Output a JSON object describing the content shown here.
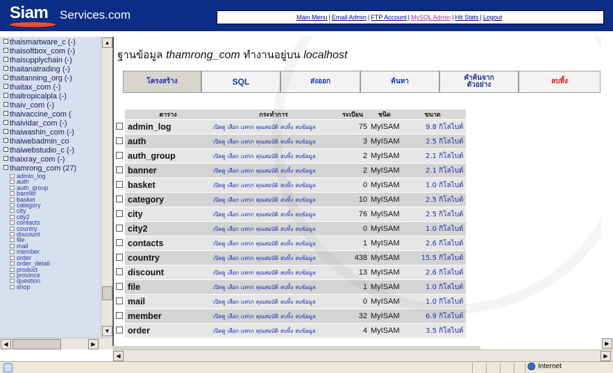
{
  "header": {
    "logo_siam": "Siam",
    "logo_rest": "Services.com",
    "nav": [
      {
        "label": "Main Menu"
      },
      {
        "label": "Email Admin"
      },
      {
        "label": "FTP Account"
      },
      {
        "label": "MySQL Admin"
      },
      {
        "label": "Hit Stats"
      },
      {
        "label": "Logout"
      }
    ]
  },
  "sidebar": {
    "databases": [
      "thaismartware_c (-)",
      "thaisoftbox_com (-)",
      "thaisupplychain (-)",
      "thaitanatrading (-)",
      "thaitanning_org (-)",
      "thaitax_com (-)",
      "thaitropicalpla (-)",
      "thaiv_com (-)",
      "thaivaccine_com (",
      "thaividar_com (-)",
      "thaiwashin_com (-)",
      "thaiwebadmin_co",
      "thaiwebstudio_c (-)",
      "thaixray_com (-)",
      "thamrong_com (27)"
    ],
    "tables": [
      "admin_log",
      "auth",
      "auth_group",
      "banner",
      "basket",
      "category",
      "city",
      "city2",
      "contacts",
      "country",
      "discount",
      "file",
      "mail",
      "member",
      "order",
      "order_detail",
      "product",
      "province",
      "question",
      "shop"
    ]
  },
  "main": {
    "title_prefix": "ฐานข้อมูล",
    "title_db": "thamrong_com",
    "title_mid": "ทำงานอยู่บน",
    "title_host": "localhost",
    "tabs": [
      {
        "label": "โครงสร้าง"
      },
      {
        "label": "SQL"
      },
      {
        "label": "ส่งออก"
      },
      {
        "label": "ค้นหา"
      },
      {
        "label": "คำค้นจาก ตัวอย่าง"
      },
      {
        "label": "ลบทิ้ง"
      }
    ],
    "columns": {
      "table": "ตาราง",
      "action": "กระทำการ",
      "records": "ระเบียน",
      "type": "ชนิด",
      "size": "ขนาด"
    },
    "actions": [
      "เปิดดู",
      "เลือก",
      "แทรก",
      "คุณสมบัติ",
      "ลบทิ้ง",
      "ลบข้อมูล"
    ],
    "rows": [
      {
        "name": "admin_log",
        "records": "75",
        "type": "MyISAM",
        "size": "9.8 กิโลไบต์"
      },
      {
        "name": "auth",
        "records": "3",
        "type": "MyISAM",
        "size": "2.5 กิโลไบต์"
      },
      {
        "name": "auth_group",
        "records": "2",
        "type": "MyISAM",
        "size": "2.1 กิโลไบต์"
      },
      {
        "name": "banner",
        "records": "2",
        "type": "MyISAM",
        "size": "2.1 กิโลไบต์"
      },
      {
        "name": "basket",
        "records": "0",
        "type": "MyISAM",
        "size": "1.0 กิโลไบต์"
      },
      {
        "name": "category",
        "records": "10",
        "type": "MyISAM",
        "size": "2.5 กิโลไบต์"
      },
      {
        "name": "city",
        "records": "76",
        "type": "MyISAM",
        "size": "2.5 กิโลไบต์"
      },
      {
        "name": "city2",
        "records": "0",
        "type": "MyISAM",
        "size": "1.0 กิโลไบต์"
      },
      {
        "name": "contacts",
        "records": "1",
        "type": "MyISAM",
        "size": "2.6 กิโลไบต์"
      },
      {
        "name": "country",
        "records": "438",
        "type": "MyISAM",
        "size": "15.5 กิโลไบต์"
      },
      {
        "name": "discount",
        "records": "13",
        "type": "MyISAM",
        "size": "2.6 กิโลไบต์"
      },
      {
        "name": "file",
        "records": "1",
        "type": "MyISAM",
        "size": "1.0 กิโลไบต์"
      },
      {
        "name": "mail",
        "records": "0",
        "type": "MyISAM",
        "size": "1.0 กิโลไบต์"
      },
      {
        "name": "member",
        "records": "32",
        "type": "MyISAM",
        "size": "6.9 กิโลไบต์"
      },
      {
        "name": "order",
        "records": "4",
        "type": "MyISAM",
        "size": "3.5 กิโลไบต์"
      }
    ]
  },
  "statusbar": {
    "zone": "Internet"
  }
}
